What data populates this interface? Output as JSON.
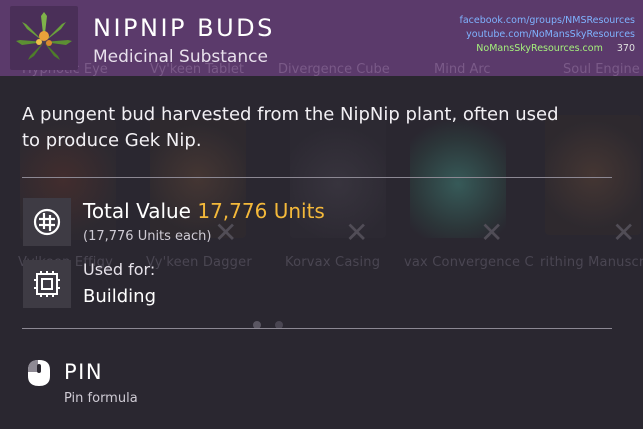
{
  "header": {
    "title": "NIPNIP BUDS",
    "subtitle": "Medicinal Substance",
    "icon": "nipnip-plant-icon",
    "accent_color": "#5b3a6b"
  },
  "watermark": {
    "line1": "facebook.com/groups/NMSResources",
    "line2": "youtube.com/NoMansSkyResources",
    "line3": "NoMansSkyResources.com",
    "page": "370"
  },
  "description": "A pungent bud harvested from the NipNip plant, often used to produce Gek Nip.",
  "value": {
    "label": "Total Value",
    "amount": "17,776 Units",
    "each": "(17,776 Units each)",
    "icon": "units-currency-icon",
    "amount_color": "#f4b93a"
  },
  "used_for": {
    "label": "Used for:",
    "value": "Building",
    "icon": "building-chip-icon"
  },
  "pin": {
    "label": "PIN",
    "sub": "Pin formula",
    "icon": "mouse-button-icon"
  },
  "background": {
    "top_labels": [
      "Hypnotic Eye",
      "Vy'keen Tablet",
      "Divergence Cube",
      "Mind Arc",
      "Soul Engine"
    ],
    "mid_labels": [
      "Vy'keen Effigy",
      "Vy'keen Dagger",
      "Korvax Casing",
      "vax Convergence C",
      "rithing Manuscript"
    ]
  }
}
